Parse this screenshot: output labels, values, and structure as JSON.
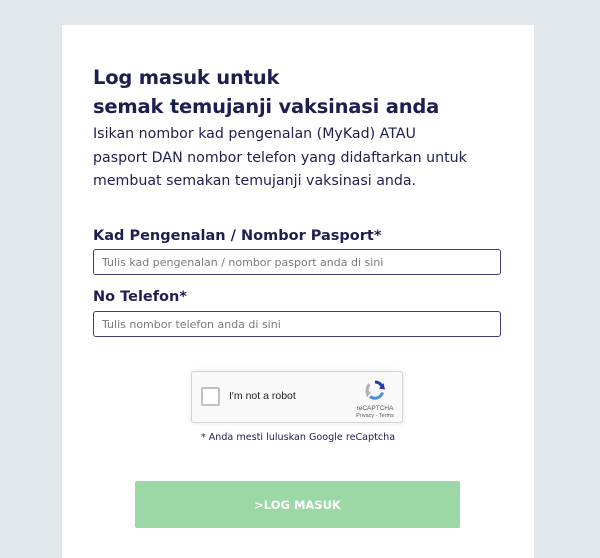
{
  "login": {
    "title_line1": "Log masuk untuk",
    "title_line2": "semak temujanji vaksinasi anda",
    "description_line1": "Isikan nombor kad pengenalan (MyKad) ATAU",
    "description_line2": "pasport DAN nombor telefon yang didaftarkan untuk",
    "description_line3": "membuat semakan temujanji vaksinasi anda.",
    "ic_label": "Kad Pengenalan / Nombor Pasport*",
    "ic_placeholder": "Tulis kad pengenalan / nombor pasport anda di sini",
    "ic_value": "",
    "phone_label": "No Telefon*",
    "phone_placeholder": "Tulis nombor telefon anda di sini",
    "phone_value": "",
    "captcha_note": "* Anda mesti luluskan Google reCaptcha",
    "submit_label": ">LOG MASUK"
  },
  "recaptcha": {
    "checkbox_label": "I'm not a robot",
    "brand": "reCAPTCHA",
    "privacy": "Privacy",
    "separator": " - ",
    "terms": "Terms",
    "checked": false
  },
  "colors": {
    "page_background": "#e1e7ea",
    "card_background": "#ffffff",
    "text_primary": "#1e1f4f",
    "button_background": "#9bd8a6",
    "button_text": "#ffffff",
    "recaptcha_blue": "#4a90e2",
    "recaptcha_dark_blue": "#1c3aa9",
    "recaptcha_gray": "#b2b2b2"
  },
  "icons": {
    "recaptcha_logo": "recaptcha-logo-icon",
    "checkbox": "checkbox-icon"
  }
}
